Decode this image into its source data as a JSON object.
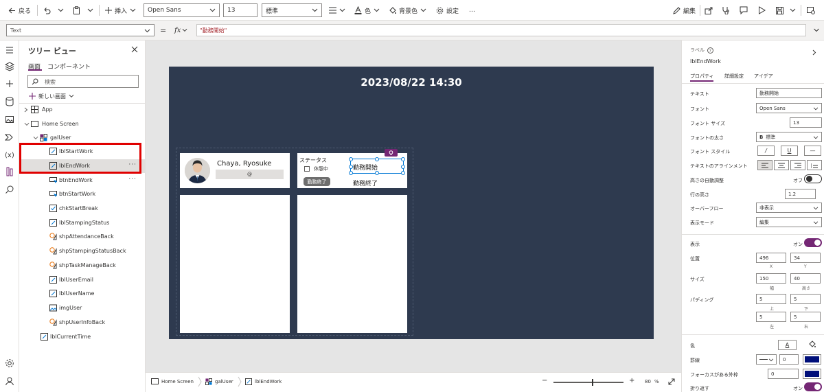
{
  "colors": {
    "accent": "#742774",
    "highlight": "#e00000",
    "canvas_bg": "#2e3a4f",
    "selection": "#0078d4"
  },
  "toolbar": {
    "back": "戻る",
    "insert": "挿入",
    "font": "Open Sans",
    "font_size": "13",
    "font_weight": "標準",
    "color": "色",
    "bg_color": "背景色",
    "settings": "設定",
    "more": "…",
    "edit": "編集"
  },
  "formula": {
    "property": "Text",
    "eq": "=",
    "fx": "fx",
    "value": "\"勤務開始\""
  },
  "tree": {
    "title": "ツリー ビュー",
    "tab_screens": "画面",
    "tab_components": "コンポーネント",
    "search_placeholder": "検索",
    "new_screen": "新しい画面",
    "items": [
      {
        "label": "App",
        "icon": "app-icon"
      },
      {
        "label": "Home Screen",
        "icon": "screen-icon"
      },
      {
        "label": "galUser",
        "icon": "gallery-icon"
      },
      {
        "label": "lblStartWork",
        "icon": "label-icon"
      },
      {
        "label": "lblEndWork",
        "icon": "label-icon"
      },
      {
        "label": "btnEndWork",
        "icon": "button-icon"
      },
      {
        "label": "btnStartWork",
        "icon": "button-icon"
      },
      {
        "label": "chkStartBreak",
        "icon": "checkbox-icon"
      },
      {
        "label": "lblStampingStatus",
        "icon": "label-icon"
      },
      {
        "label": "shpAttendanceBack",
        "icon": "shape-icon"
      },
      {
        "label": "shpStampingStatusBack",
        "icon": "shape-icon"
      },
      {
        "label": "shpTaskManageBack",
        "icon": "shape-icon"
      },
      {
        "label": "lblUserEmail",
        "icon": "label-icon"
      },
      {
        "label": "lblUserName",
        "icon": "label-icon"
      },
      {
        "label": "imgUser",
        "icon": "image-icon"
      },
      {
        "label": "shpUserInfoBack",
        "icon": "shape-icon"
      },
      {
        "label": "lblCurrentTime",
        "icon": "label-icon"
      }
    ],
    "more": "···"
  },
  "canvas": {
    "datetime": "2023/08/22 14:30",
    "user_name": "Chaya, Ryosuke",
    "user_email_at": "@",
    "status_label": "ステータス",
    "break_label": "休憩中",
    "end_button": "勤務終了",
    "start_work": "勤務開始",
    "end_work": "勤務終了"
  },
  "statusbar": {
    "crumbs": [
      "Home Screen",
      "galUser",
      "lblEndWork"
    ],
    "minus": "−",
    "plus": "+",
    "zoom": "80",
    "pct": "%",
    "zoom_level": 0.55
  },
  "props": {
    "type": "ラベル",
    "name": "lblEndWork",
    "tabs": [
      "プロパティ",
      "詳細設定",
      "アイデア"
    ],
    "text_label": "テキスト",
    "text_value": "勤務開始",
    "font_label": "フォント",
    "font_value": "Open Sans",
    "size_label": "フォント サイズ",
    "size_value": "13",
    "weight_label": "フォントの太さ",
    "weight_value": "標準",
    "weight_b": "B",
    "style_label": "フォント スタイル",
    "style_italic": "/",
    "style_underline": "U",
    "style_strike": "—",
    "align_label": "テキストのアラインメント",
    "autoheight_label": "高さの自動調整",
    "autoheight_value": "オフ",
    "lineheight_label": "行の高さ",
    "lineheight_value": "1.2",
    "overflow_label": "オーバーフロー",
    "overflow_value": "非表示",
    "mode_label": "表示モード",
    "mode_value": "編集",
    "visible_label": "表示",
    "visible_value": "オン",
    "position_label": "位置",
    "x_value": "496",
    "y_value": "34",
    "x_caption": "X",
    "y_caption": "Y",
    "size2_label": "サイズ",
    "w_value": "150",
    "h_value": "40",
    "w_caption": "幅",
    "h_caption": "高さ",
    "padding_label": "パディング",
    "pad_top": "5",
    "pad_bottom": "5",
    "pad_left": "5",
    "pad_right": "5",
    "pad_top_caption": "上",
    "pad_bottom_caption": "下",
    "pad_left_caption": "左",
    "pad_right_caption": "右",
    "color_label": "色",
    "color_a": "A",
    "border_label": "罫線",
    "border_width": "0",
    "focus_label": "フォーカスがある外枠",
    "focus_value": "0",
    "wrap_label": "折り返す",
    "wrap_value": "オン"
  }
}
